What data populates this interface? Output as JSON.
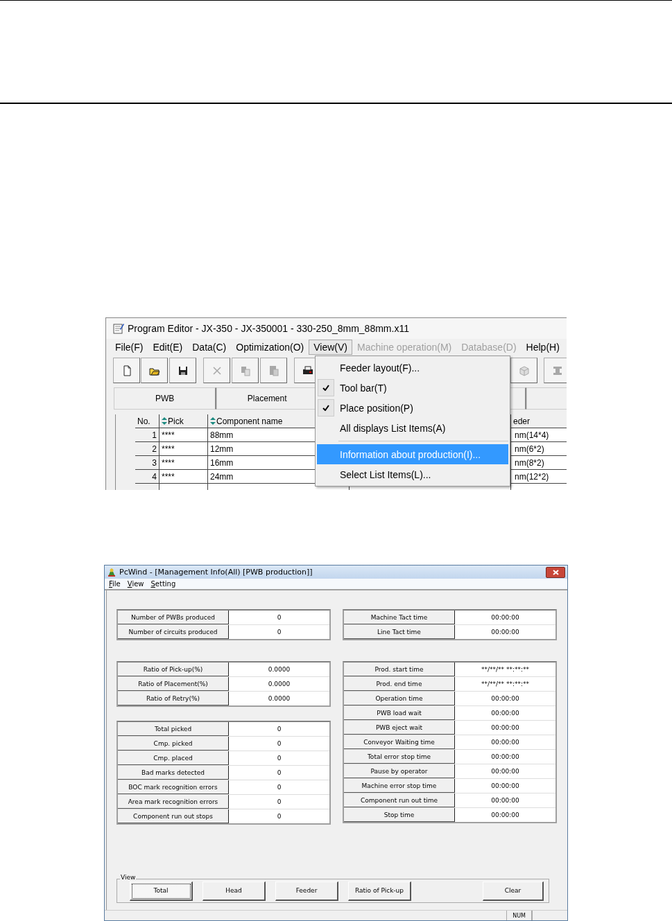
{
  "program_editor": {
    "title": "Program Editor - JX-350 - JX-350001 - 330-250_8mm_88mm.x11",
    "menu": [
      {
        "label": "File(F)",
        "disabled": false,
        "selected": false
      },
      {
        "label": "Edit(E)",
        "disabled": false,
        "selected": false
      },
      {
        "label": "Data(C)",
        "disabled": false,
        "selected": false
      },
      {
        "label": "Optimization(O)",
        "disabled": false,
        "selected": false
      },
      {
        "label": "View(V)",
        "disabled": false,
        "selected": true
      },
      {
        "label": "Machine operation(M)",
        "disabled": true,
        "selected": false
      },
      {
        "label": "Database(D)",
        "disabled": true,
        "selected": false
      },
      {
        "label": "Help(H)",
        "disabled": false,
        "selected": false
      }
    ],
    "toolbar": [
      {
        "disabled": false
      },
      {
        "disabled": false
      },
      {
        "disabled": false
      },
      {
        "disabled": true
      },
      {
        "disabled": true
      },
      {
        "disabled": true
      },
      {
        "disabled": false
      },
      {
        "disabled": true
      },
      {
        "disabled": true
      }
    ],
    "tabs": [
      {
        "label": "PWB"
      },
      {
        "label": "Placement"
      }
    ],
    "table": {
      "columns": [
        {
          "label": "No.",
          "sortable": false
        },
        {
          "label": "Pick",
          "sortable": true
        },
        {
          "label": "Component name",
          "sortable": true
        },
        {
          "label": "eder",
          "sortable": false
        }
      ],
      "rows": [
        {
          "no": "1",
          "pick": "****",
          "name": "88mm",
          "feeder": "nm(14*4)"
        },
        {
          "no": "2",
          "pick": "****",
          "name": "12mm",
          "feeder": "nm(6*2)"
        },
        {
          "no": "3",
          "pick": "****",
          "name": "16mm",
          "feeder": "nm(8*2)"
        },
        {
          "no": "4",
          "pick": "****",
          "name": "24mm",
          "feeder": "nm(12*2)"
        }
      ]
    },
    "view_menu": [
      {
        "kind": "item",
        "label": "Feeder layout(F)...",
        "checked": false,
        "selected": false
      },
      {
        "kind": "item",
        "label": "Tool bar(T)",
        "checked": true,
        "selected": false
      },
      {
        "kind": "item",
        "label": "Place position(P)",
        "checked": true,
        "selected": false
      },
      {
        "kind": "item",
        "label": "All displays List Items(A)",
        "checked": false,
        "selected": false
      },
      {
        "kind": "separator"
      },
      {
        "kind": "item",
        "label": "Information about production(I)...",
        "checked": false,
        "selected": true
      },
      {
        "kind": "item",
        "label": "Select List Items(L)...",
        "checked": false,
        "selected": false
      }
    ]
  },
  "pcwind": {
    "title": "PcWind - [Management Info(All) [PWB production]]",
    "menu": [
      "File",
      "View",
      "Setting"
    ],
    "left_groups": [
      [
        {
          "label": "Number of PWBs produced",
          "value": "0"
        },
        {
          "label": "Number of circuits produced",
          "value": "0"
        }
      ],
      [
        {
          "label": "Ratio of Pick-up(%)",
          "value": "0.0000"
        },
        {
          "label": "Ratio of Placement(%)",
          "value": "0.0000"
        },
        {
          "label": "Ratio of Retry(%)",
          "value": "0.0000"
        }
      ],
      [
        {
          "label": "Total picked",
          "value": "0"
        },
        {
          "label": "Cmp. picked",
          "value": "0"
        },
        {
          "label": "Cmp. placed",
          "value": "0"
        },
        {
          "label": "Bad marks detected",
          "value": "0"
        },
        {
          "label": "BOC mark recognition errors",
          "value": "0"
        },
        {
          "label": "Area mark recognition errors",
          "value": "0"
        },
        {
          "label": "Component run out stops",
          "value": "0"
        }
      ]
    ],
    "right_groups": [
      [
        {
          "label": "Machine Tact time",
          "value": "00:00:00"
        },
        {
          "label": "Line Tact time",
          "value": "00:00:00"
        }
      ],
      [
        {
          "label": "Prod. start time",
          "value": "**/**/** **:**:**"
        },
        {
          "label": "Prod. end time",
          "value": "**/**/** **:**:**"
        },
        {
          "label": "Operation time",
          "value": "00:00:00"
        },
        {
          "label": "PWB load wait",
          "value": "00:00:00"
        },
        {
          "label": "PWB eject wait",
          "value": "00:00:00"
        },
        {
          "label": "Conveyor Waiting time",
          "value": "00:00:00"
        },
        {
          "label": "Total error stop time",
          "value": "00:00:00"
        },
        {
          "label": "Pause by operator",
          "value": "00:00:00"
        },
        {
          "label": "Machine error stop time",
          "value": "00:00:00"
        },
        {
          "label": "Component run out time",
          "value": "00:00:00"
        },
        {
          "label": "Stop time",
          "value": "00:00:00"
        }
      ]
    ],
    "view_group": {
      "label": "View",
      "buttons": [
        {
          "label": "Total",
          "focused": true
        },
        {
          "label": "Head",
          "focused": false
        },
        {
          "label": "Feeder",
          "focused": false
        },
        {
          "label": "Ratio of Pick-up",
          "focused": false
        }
      ]
    },
    "clear_button": "Clear",
    "status_bar": {
      "indicator": "NUM"
    }
  }
}
